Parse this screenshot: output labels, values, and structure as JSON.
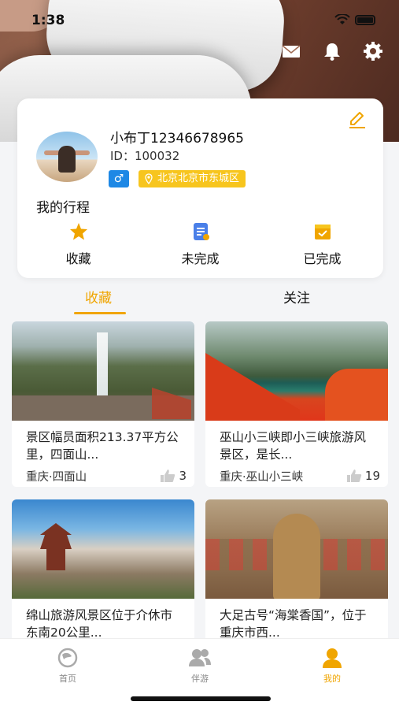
{
  "status_bar": {
    "time": "1:38"
  },
  "profile": {
    "name": "小布丁12346678965",
    "id_text": "ID：100032",
    "gender_symbol": "♂",
    "location": "北京北京市东城区"
  },
  "trip": {
    "title": "我的行程",
    "items": [
      {
        "label": "收藏",
        "icon": "star-icon",
        "color": "#f0a500"
      },
      {
        "label": "未完成",
        "icon": "document-icon",
        "color": "#4a7fe8"
      },
      {
        "label": "已完成",
        "icon": "check-box-icon",
        "color": "#f0a500"
      }
    ]
  },
  "tabs": [
    {
      "label": "收藏",
      "active": true
    },
    {
      "label": "关注",
      "active": false
    }
  ],
  "posts": [
    {
      "desc": "景区幅员面积213.37平方公里，四面山...",
      "place": "重庆·四面山",
      "likes": "3"
    },
    {
      "desc": "巫山小三峡即小三峡旅游风景区，是长...",
      "place": "重庆·巫山小三峡",
      "likes": "19"
    },
    {
      "desc": "绵山旅游风景区位于介休市东南20公里...",
      "place": "",
      "likes": ""
    },
    {
      "desc": "大足古号“海棠香国”，位于重庆市西...",
      "place": "",
      "likes": ""
    }
  ],
  "tabbar": [
    {
      "label": "首页",
      "active": false
    },
    {
      "label": "伴游",
      "active": false
    },
    {
      "label": "我的",
      "active": true
    }
  ],
  "colors": {
    "accent": "#f0a500",
    "gender": "#1e88e5",
    "location_badge": "#f7c51e"
  }
}
